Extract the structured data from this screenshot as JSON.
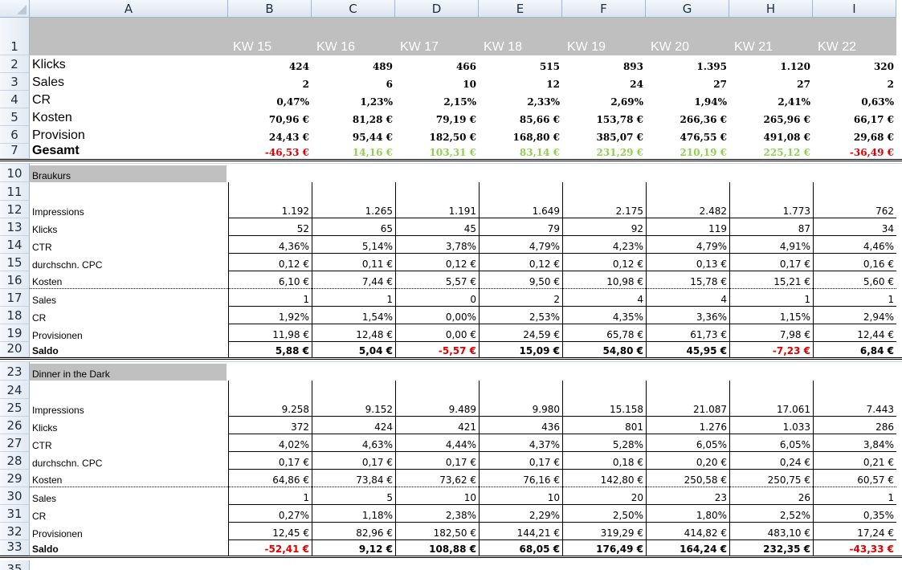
{
  "columns": [
    "A",
    "B",
    "C",
    "D",
    "E",
    "F",
    "G",
    "H",
    "I"
  ],
  "weeks": [
    "KW 15",
    "KW 16",
    "KW 17",
    "KW 18",
    "KW 19",
    "KW 20",
    "KW 21",
    "KW 22"
  ],
  "summary": [
    {
      "row": "2",
      "label": "Klicks",
      "values": [
        "424",
        "489",
        "466",
        "515",
        "893",
        "1.395",
        "1.120",
        "320"
      ]
    },
    {
      "row": "3",
      "label": "Sales",
      "values": [
        "2",
        "6",
        "10",
        "12",
        "24",
        "27",
        "27",
        "2"
      ]
    },
    {
      "row": "4",
      "label": "CR",
      "values": [
        "0,47%",
        "1,23%",
        "2,15%",
        "2,33%",
        "2,69%",
        "1,94%",
        "2,41%",
        "0,63%"
      ]
    },
    {
      "row": "5",
      "label": "Kosten",
      "values": [
        "70,96 €",
        "81,28 €",
        "79,19 €",
        "85,66 €",
        "153,78 €",
        "266,36 €",
        "265,96 €",
        "66,17 €"
      ]
    },
    {
      "row": "6",
      "label": "Provision",
      "values": [
        "24,43 €",
        "95,44 €",
        "182,50 €",
        "168,80 €",
        "385,07 €",
        "476,55 €",
        "491,08 €",
        "29,68 €"
      ]
    },
    {
      "row": "7",
      "label": "Gesamt",
      "values": [
        "-46,53 €",
        "14,16 €",
        "103,31 €",
        "83,14 €",
        "231,29 €",
        "210,19 €",
        "225,12 €",
        "-36,49 €"
      ],
      "colors": [
        "red",
        "green",
        "green",
        "green",
        "green",
        "green",
        "green",
        "red"
      ]
    }
  ],
  "sections": [
    {
      "title_row": "10",
      "title": "Braukurs",
      "blank_row": "11",
      "rows": [
        {
          "row": "12",
          "label": "Impressions",
          "values": [
            "1.192",
            "1.265",
            "1.191",
            "1.649",
            "2.175",
            "2.482",
            "1.773",
            "762"
          ]
        },
        {
          "row": "13",
          "label": "Klicks",
          "values": [
            "52",
            "65",
            "45",
            "79",
            "92",
            "119",
            "87",
            "34"
          ]
        },
        {
          "row": "14",
          "label": "CTR",
          "values": [
            "4,36%",
            "5,14%",
            "3,78%",
            "4,79%",
            "4,23%",
            "4,79%",
            "4,91%",
            "4,46%"
          ]
        },
        {
          "row": "15",
          "label": "durchschn. CPC",
          "values": [
            "0,12 €",
            "0,11 €",
            "0,12 €",
            "0,12 €",
            "0,12 €",
            "0,13 €",
            "0,17 €",
            "0,16 €"
          ]
        },
        {
          "row": "16",
          "label": "Kosten",
          "values": [
            "6,10 €",
            "7,44 €",
            "5,57 €",
            "9,50 €",
            "10,98 €",
            "15,78 €",
            "15,21 €",
            "5,60 €"
          ]
        },
        {
          "row": "17",
          "label": "Sales",
          "values": [
            "1",
            "1",
            "0",
            "2",
            "4",
            "4",
            "1",
            "1"
          ]
        },
        {
          "row": "18",
          "label": "CR",
          "values": [
            "1,92%",
            "1,54%",
            "0,00%",
            "2,53%",
            "4,35%",
            "3,36%",
            "1,15%",
            "2,94%"
          ]
        },
        {
          "row": "19",
          "label": "Provisionen",
          "values": [
            "11,98 €",
            "12,48 €",
            "0,00 €",
            "24,59 €",
            "65,78 €",
            "61,73 €",
            "7,98 €",
            "12,44 €"
          ]
        },
        {
          "row": "20",
          "label": "Saldo",
          "values": [
            "5,88 €",
            "5,04 €",
            "-5,57 €",
            "15,09 €",
            "54,80 €",
            "45,95 €",
            "-7,23 €",
            "6,84 €"
          ],
          "colors": [
            "",
            "",
            "red",
            "",
            "",
            "",
            "red",
            ""
          ]
        }
      ]
    },
    {
      "title_row": "23",
      "title": "Dinner in the Dark",
      "blank_row": "24",
      "rows": [
        {
          "row": "25",
          "label": "Impressions",
          "values": [
            "9.258",
            "9.152",
            "9.489",
            "9.980",
            "15.158",
            "21.087",
            "17.061",
            "7.443"
          ]
        },
        {
          "row": "26",
          "label": "Klicks",
          "values": [
            "372",
            "424",
            "421",
            "436",
            "801",
            "1.276",
            "1.033",
            "286"
          ]
        },
        {
          "row": "27",
          "label": "CTR",
          "values": [
            "4,02%",
            "4,63%",
            "4,44%",
            "4,37%",
            "5,28%",
            "6,05%",
            "6,05%",
            "3,84%"
          ]
        },
        {
          "row": "28",
          "label": "durchschn. CPC",
          "values": [
            "0,17 €",
            "0,17 €",
            "0,17 €",
            "0,17 €",
            "0,18 €",
            "0,20 €",
            "0,24 €",
            "0,21 €"
          ]
        },
        {
          "row": "29",
          "label": "Kosten",
          "values": [
            "64,86 €",
            "73,84 €",
            "73,62 €",
            "76,16 €",
            "142,80 €",
            "250,58 €",
            "250,75 €",
            "60,57 €"
          ]
        },
        {
          "row": "30",
          "label": "Sales",
          "values": [
            "1",
            "5",
            "10",
            "10",
            "20",
            "23",
            "26",
            "1"
          ]
        },
        {
          "row": "31",
          "label": "CR",
          "values": [
            "0,27%",
            "1,18%",
            "2,38%",
            "2,29%",
            "2,50%",
            "1,80%",
            "2,52%",
            "0,35%"
          ]
        },
        {
          "row": "32",
          "label": "Provisionen",
          "values": [
            "12,45 €",
            "82,96 €",
            "182,50 €",
            "144,21 €",
            "319,29 €",
            "414,82 €",
            "483,10 €",
            "17,24 €"
          ]
        },
        {
          "row": "33",
          "label": "Saldo",
          "values": [
            "-52,41 €",
            "9,12 €",
            "108,88 €",
            "68,05 €",
            "176,49 €",
            "164,24 €",
            "232,35 €",
            "-43,33 €"
          ],
          "colors": [
            "red",
            "",
            "",
            "",
            "",
            "",
            "",
            "red"
          ]
        }
      ]
    }
  ],
  "trailing_row": "35",
  "colors": {
    "header_gray": "#bfbfbf",
    "negative": "#e00000",
    "positive": "#92d050",
    "section_bar": "#c0c0c0"
  }
}
